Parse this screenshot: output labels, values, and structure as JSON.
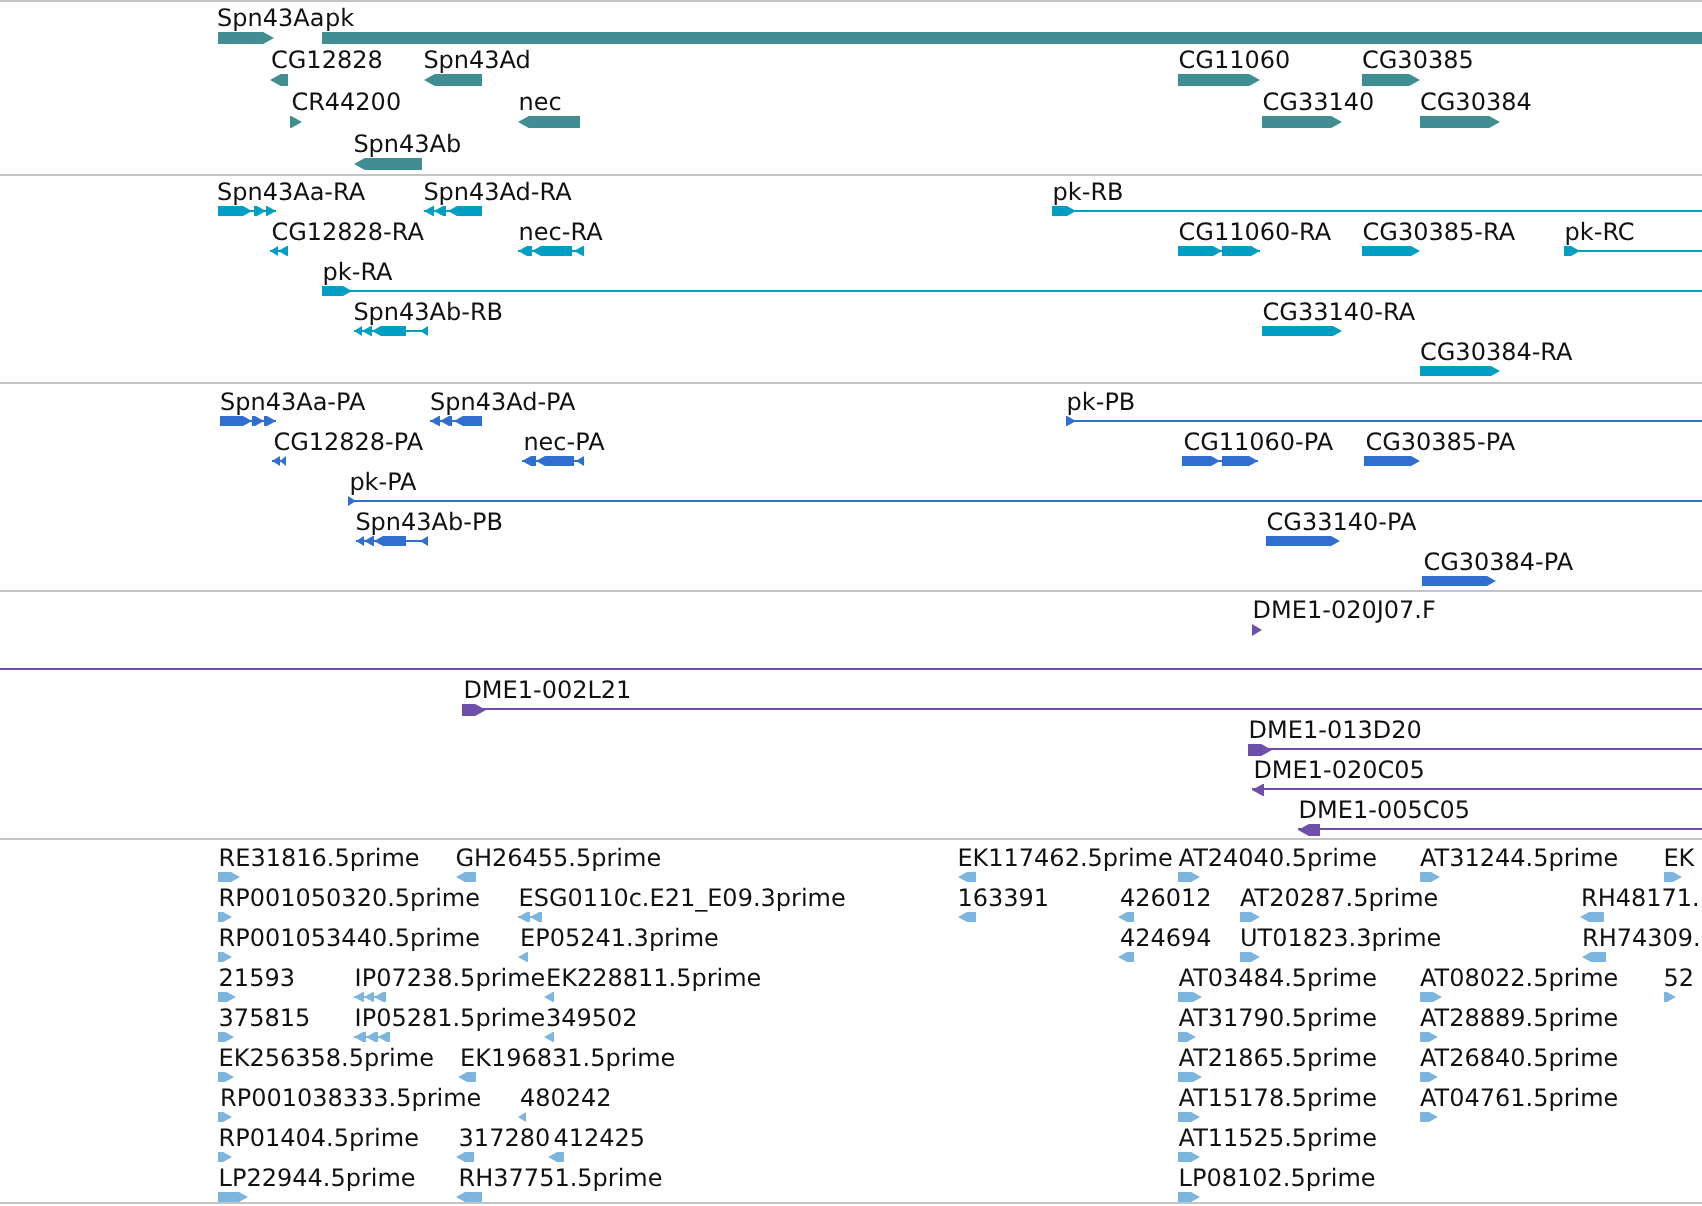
{
  "tracks": [
    {
      "color": "#408e92",
      "features": [
        {
          "label": "Spn43Aa",
          "reverse": false
        },
        {
          "label": "pk",
          "reverse": false
        },
        {
          "label": "CG12828",
          "reverse": true
        },
        {
          "label": "Spn43Ad",
          "reverse": true
        },
        {
          "label": "CG11060",
          "reverse": false
        },
        {
          "label": "CG30385",
          "reverse": false
        },
        {
          "label": "CR44200",
          "reverse": false
        },
        {
          "label": "nec",
          "reverse": true
        },
        {
          "label": "CG33140",
          "reverse": false
        },
        {
          "label": "CG30384",
          "reverse": false
        },
        {
          "label": "Spn43Ab",
          "reverse": true
        }
      ]
    },
    {
      "color": "#009ec2",
      "features": [
        {
          "label": "Spn43Aa-RA",
          "reverse": false
        },
        {
          "label": "Spn43Ad-RA",
          "reverse": true
        },
        {
          "label": "pk-RB",
          "reverse": false
        },
        {
          "label": "CG12828-RA",
          "reverse": true
        },
        {
          "label": "nec-RA",
          "reverse": true
        },
        {
          "label": "CG11060-RA",
          "reverse": false
        },
        {
          "label": "CG30385-RA",
          "reverse": false
        },
        {
          "label": "pk-RC",
          "reverse": false
        },
        {
          "label": "pk-RA",
          "reverse": false
        },
        {
          "label": "Spn43Ab-RB",
          "reverse": true
        },
        {
          "label": "CG33140-RA",
          "reverse": false
        },
        {
          "label": "CG30384-RA",
          "reverse": false
        }
      ]
    },
    {
      "color": "#306ed0",
      "features": [
        {
          "label": "Spn43Aa-PA",
          "reverse": false
        },
        {
          "label": "Spn43Ad-PA",
          "reverse": true
        },
        {
          "label": "pk-PB",
          "reverse": false
        },
        {
          "label": "CG12828-PA",
          "reverse": true
        },
        {
          "label": "nec-PA",
          "reverse": true
        },
        {
          "label": "CG11060-PA",
          "reverse": false
        },
        {
          "label": "CG30385-PA",
          "reverse": false
        },
        {
          "label": "pk-PA",
          "reverse": false
        },
        {
          "label": "Spn43Ab-PB",
          "reverse": true
        },
        {
          "label": "CG33140-PA",
          "reverse": false
        },
        {
          "label": "CG30384-PA",
          "reverse": false
        }
      ]
    },
    {
      "color": "#6e50aa",
      "features": [
        {
          "kind": "clone",
          "label": "DME1-020J07.F",
          "reverse": false
        },
        {
          "kind": "span"
        },
        {
          "kind": "clone",
          "label": "DME1-002L21",
          "reverse": false
        },
        {
          "kind": "clone",
          "label": "DME1-013D20",
          "reverse": false
        },
        {
          "kind": "clone",
          "label": "DME1-020C05",
          "reverse": true
        },
        {
          "kind": "clone",
          "label": "DME1-005C05",
          "reverse": true
        }
      ]
    },
    {
      "color": "#7cb6de",
      "features": [
        {
          "label": "RE31816.5prime",
          "reverse": false
        },
        {
          "label": "GH26455.5prime",
          "reverse": true
        },
        {
          "label": "EK117462.5prime",
          "reverse": true
        },
        {
          "label": "AT24040.5prime",
          "reverse": false
        },
        {
          "label": "AT31244.5prime",
          "reverse": false
        },
        {
          "label": "EK",
          "reverse": false
        },
        {
          "label": "RP001050320.5prime",
          "reverse": false
        },
        {
          "label": "ESG0110c.E21_E09.3prime",
          "reverse": true
        },
        {
          "label": "163391",
          "reverse": true
        },
        {
          "label": "426012",
          "reverse": true
        },
        {
          "label": "AT20287.5prime",
          "reverse": false
        },
        {
          "label": "RH48171.",
          "reverse": true
        },
        {
          "label": "RP001053440.5prime",
          "reverse": false
        },
        {
          "label": "EP05241.3prime",
          "reverse": true
        },
        {
          "label": "424694",
          "reverse": true
        },
        {
          "label": "UT01823.3prime",
          "reverse": false
        },
        {
          "label": "RH74309.",
          "reverse": true
        },
        {
          "label": "21593",
          "reverse": false
        },
        {
          "label": "IP07238.5prime",
          "reverse": true
        },
        {
          "label": "EK228811.5prime",
          "reverse": true
        },
        {
          "label": "AT03484.5prime",
          "reverse": false
        },
        {
          "label": "AT08022.5prime",
          "reverse": false
        },
        {
          "label": "52",
          "reverse": false
        },
        {
          "label": "375815",
          "reverse": false
        },
        {
          "label": "IP05281.5prime",
          "reverse": true
        },
        {
          "label": "349502",
          "reverse": true
        },
        {
          "label": "AT31790.5prime",
          "reverse": false
        },
        {
          "label": "AT28889.5prime",
          "reverse": false
        },
        {
          "label": "EK256358.5prime",
          "reverse": false
        },
        {
          "label": "EK196831.5prime",
          "reverse": true
        },
        {
          "label": "AT21865.5prime",
          "reverse": false
        },
        {
          "label": "AT26840.5prime",
          "reverse": false
        },
        {
          "label": "RP001038333.5prime",
          "reverse": false
        },
        {
          "label": "480242",
          "reverse": true
        },
        {
          "label": "AT15178.5prime",
          "reverse": false
        },
        {
          "label": "AT04761.5prime",
          "reverse": false
        },
        {
          "label": "RP01404.5prime",
          "reverse": false
        },
        {
          "label": "317280",
          "reverse": true
        },
        {
          "label": "412425",
          "reverse": true
        },
        {
          "label": "AT11525.5prime",
          "reverse": false
        },
        {
          "label": "LP22944.5prime",
          "reverse": false
        },
        {
          "label": "RH37751.5prime",
          "reverse": true
        },
        {
          "label": "LP08102.5prime",
          "reverse": false
        }
      ]
    }
  ]
}
